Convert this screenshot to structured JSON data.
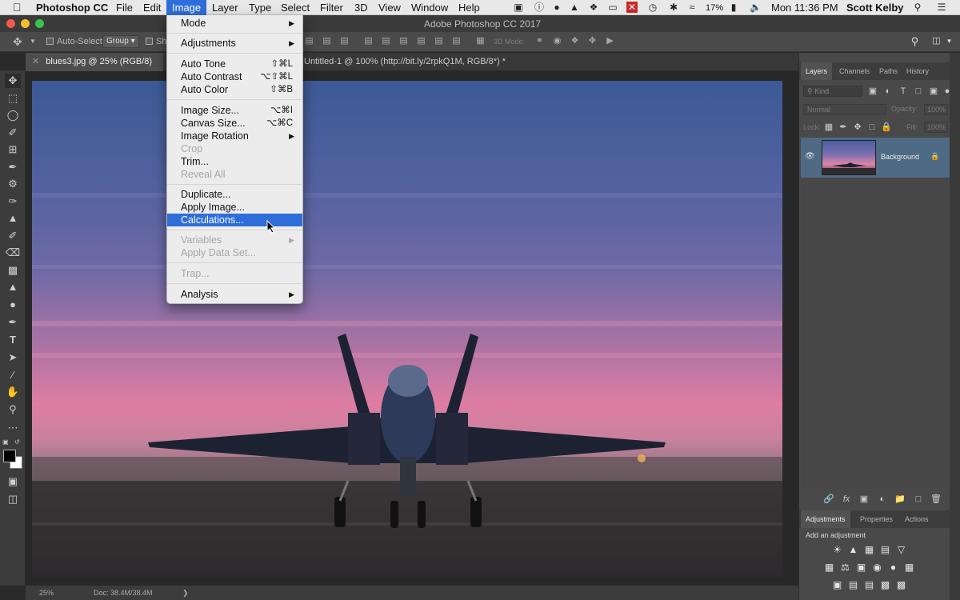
{
  "menubar": {
    "app_name": "Photoshop CC",
    "items": [
      "File",
      "Edit",
      "Image",
      "Layer",
      "Type",
      "Select",
      "Filter",
      "3D",
      "View",
      "Window",
      "Help"
    ],
    "active_item": "Image",
    "battery": "17%",
    "clock": "Mon 11:36 PM",
    "user": "Scott Kelby"
  },
  "window": {
    "title": "Adobe Photoshop CC 2017"
  },
  "options_bar": {
    "auto_select_label": "Auto-Select:",
    "group_value": "Group",
    "show_label": "Sh",
    "mode_3d_label": "3D Mode:"
  },
  "tabs": [
    {
      "label": "blues3.jpg @ 25% (RGB/8) *"
    },
    {
      "label": "Untitled-1 @ 100% (http://bit.ly/2rpkQ1M, RGB/8*) *"
    }
  ],
  "image_menu": {
    "items": [
      {
        "label": "Mode",
        "shortcut": "",
        "submenu": true,
        "disabled": false
      },
      {
        "label": "Adjustments",
        "shortcut": "",
        "submenu": true,
        "disabled": false
      },
      {
        "label": "Auto Tone",
        "shortcut": "⇧⌘L",
        "submenu": false,
        "disabled": false
      },
      {
        "label": "Auto Contrast",
        "shortcut": "⌥⇧⌘L",
        "submenu": false,
        "disabled": false
      },
      {
        "label": "Auto Color",
        "shortcut": "⇧⌘B",
        "submenu": false,
        "disabled": false
      },
      {
        "label": "Image Size...",
        "shortcut": "⌥⌘I",
        "submenu": false,
        "disabled": false
      },
      {
        "label": "Canvas Size...",
        "shortcut": "⌥⌘C",
        "submenu": false,
        "disabled": false
      },
      {
        "label": "Image Rotation",
        "shortcut": "",
        "submenu": true,
        "disabled": false
      },
      {
        "label": "Crop",
        "shortcut": "",
        "submenu": false,
        "disabled": true
      },
      {
        "label": "Trim...",
        "shortcut": "",
        "submenu": false,
        "disabled": false
      },
      {
        "label": "Reveal All",
        "shortcut": "",
        "submenu": false,
        "disabled": true
      },
      {
        "label": "Duplicate...",
        "shortcut": "",
        "submenu": false,
        "disabled": false
      },
      {
        "label": "Apply Image...",
        "shortcut": "",
        "submenu": false,
        "disabled": false
      },
      {
        "label": "Calculations...",
        "shortcut": "",
        "submenu": false,
        "disabled": false,
        "highlighted": true
      },
      {
        "label": "Variables",
        "shortcut": "",
        "submenu": true,
        "disabled": true
      },
      {
        "label": "Apply Data Set...",
        "shortcut": "",
        "submenu": false,
        "disabled": true
      },
      {
        "label": "Trap...",
        "shortcut": "",
        "submenu": false,
        "disabled": true
      },
      {
        "label": "Analysis",
        "shortcut": "",
        "submenu": true,
        "disabled": false
      }
    ]
  },
  "layers_panel": {
    "tabs": [
      "Layers",
      "Channels",
      "Paths",
      "History"
    ],
    "active_tab": "Layers",
    "kind_label": "Kind",
    "blend_mode": "Normal",
    "opacity_label": "Opacity:",
    "opacity_value": "100%",
    "lock_label": "Lock:",
    "fill_label": "Fill:",
    "fill_value": "100%",
    "layers": [
      {
        "name": "Background",
        "visible": true,
        "locked": true
      }
    ]
  },
  "adjustments_panel": {
    "tabs": [
      "Adjustments",
      "Properties",
      "Actions"
    ],
    "active_tab": "Adjustments",
    "hint": "Add an adjustment"
  },
  "status_bar": {
    "zoom": "25%",
    "doc_info": "Doc: 38.4M/38.4M"
  },
  "colors": {
    "menu_highlight": "#2f6ed9",
    "panel_bg": "#494949",
    "layer_selected": "#4f6a85"
  }
}
